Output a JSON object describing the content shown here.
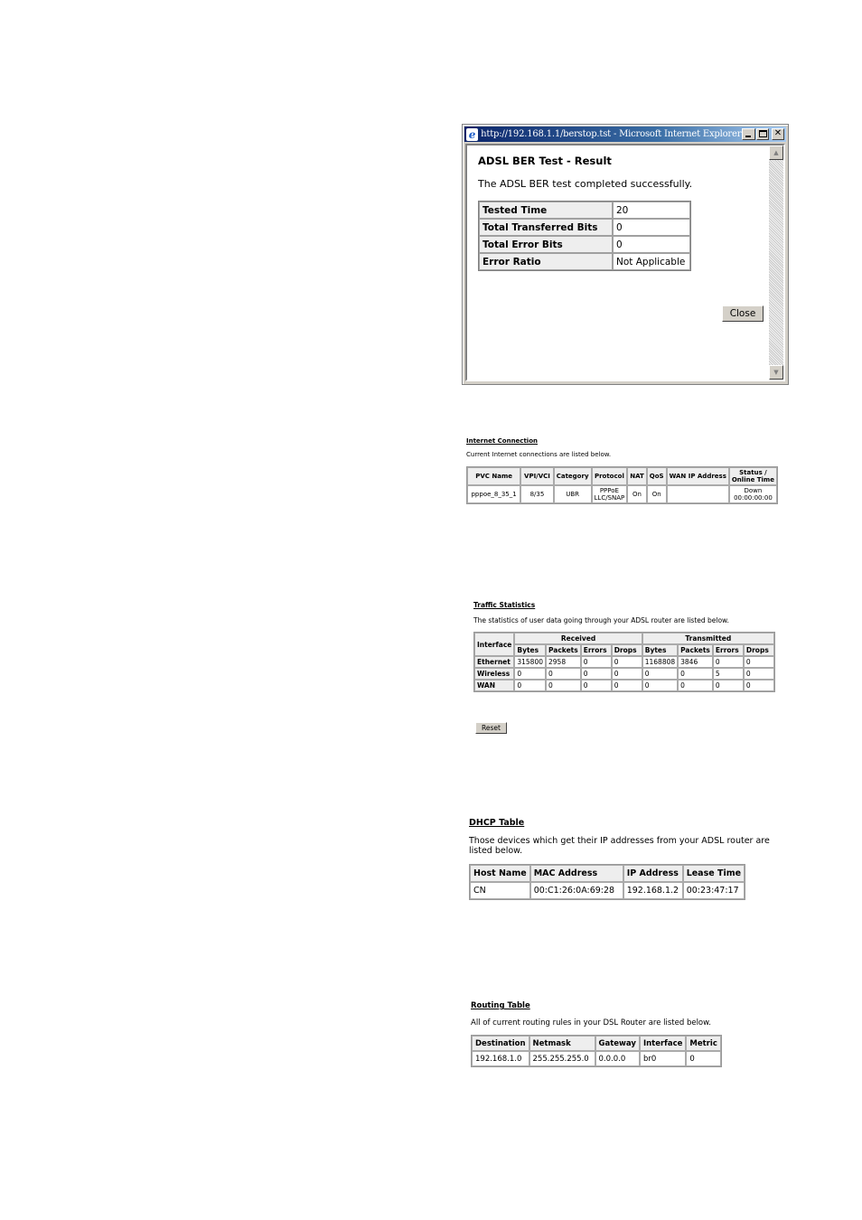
{
  "ber_popup": {
    "window_title": "http://192.168.1.1/berstop.tst - Microsoft Internet Explorer",
    "icons": {
      "app": "ie-logo-icon",
      "minimize": "minimize-icon",
      "maximize": "maximize-icon",
      "close": "close-icon"
    },
    "heading": "ADSL BER Test - Result",
    "message": "The ADSL BER test completed successfully.",
    "rows": [
      {
        "label": "Tested Time",
        "value": "20"
      },
      {
        "label": "Total Transferred Bits",
        "value": "0"
      },
      {
        "label": "Total Error Bits",
        "value": "0"
      },
      {
        "label": "Error Ratio",
        "value": "Not Applicable"
      }
    ],
    "close_label": "Close",
    "scroll_up_glyph": "▲",
    "scroll_down_glyph": "▼"
  },
  "internet_connection": {
    "title": "Internet Connection",
    "description": "Current Internet connections are listed below.",
    "headers": [
      "PVC Name",
      "VPI/VCI",
      "Category",
      "Protocol",
      "NAT",
      "QoS",
      "WAN IP Address",
      "Status /",
      "Online Time"
    ],
    "rows": [
      {
        "pvc_name": "pppoe_8_35_1",
        "vpi_vci": "8/35",
        "category": "UBR",
        "protocol_1": "PPPoE",
        "protocol_2": "LLC/SNAP",
        "nat": "On",
        "qos": "On",
        "wan_ip": "",
        "status": "Down",
        "online_time": "00:00:00:00"
      }
    ]
  },
  "traffic_statistics": {
    "title": "Traffic Statistics",
    "description": "The statistics of user data going through your ADSL router are listed below.",
    "interface_header": "Interface",
    "group_headers": [
      "Received",
      "Transmitted"
    ],
    "sub_headers": [
      "Bytes",
      "Packets",
      "Errors",
      "Drops",
      "Bytes",
      "Packets",
      "Errors",
      "Drops"
    ],
    "rows": [
      {
        "interface": "Ethernet",
        "values": [
          "315800",
          "2958",
          "0",
          "0",
          "1168808",
          "3846",
          "0",
          "0"
        ]
      },
      {
        "interface": "Wireless",
        "values": [
          "0",
          "0",
          "0",
          "0",
          "0",
          "0",
          "5",
          "0"
        ]
      },
      {
        "interface": "WAN",
        "values": [
          "0",
          "0",
          "0",
          "0",
          "0",
          "0",
          "0",
          "0"
        ]
      }
    ],
    "reset_label": "Reset"
  },
  "dhcp_table": {
    "title": "DHCP Table",
    "description": "Those devices which get their IP addresses from your ADSL router are listed below.",
    "headers": [
      "Host Name",
      "MAC Address",
      "IP Address",
      "Lease Time"
    ],
    "rows": [
      [
        "CN",
        "00:C1:26:0A:69:28",
        "192.168.1.2",
        "00:23:47:17"
      ]
    ]
  },
  "routing_table": {
    "title": "Routing Table",
    "description": "All of current routing rules in your DSL Router are listed below.",
    "headers": [
      "Destination",
      "Netmask",
      "Gateway",
      "Interface",
      "Metric"
    ],
    "rows": [
      [
        "192.168.1.0",
        "255.255.255.0",
        "0.0.0.0",
        "br0",
        "0"
      ]
    ]
  }
}
